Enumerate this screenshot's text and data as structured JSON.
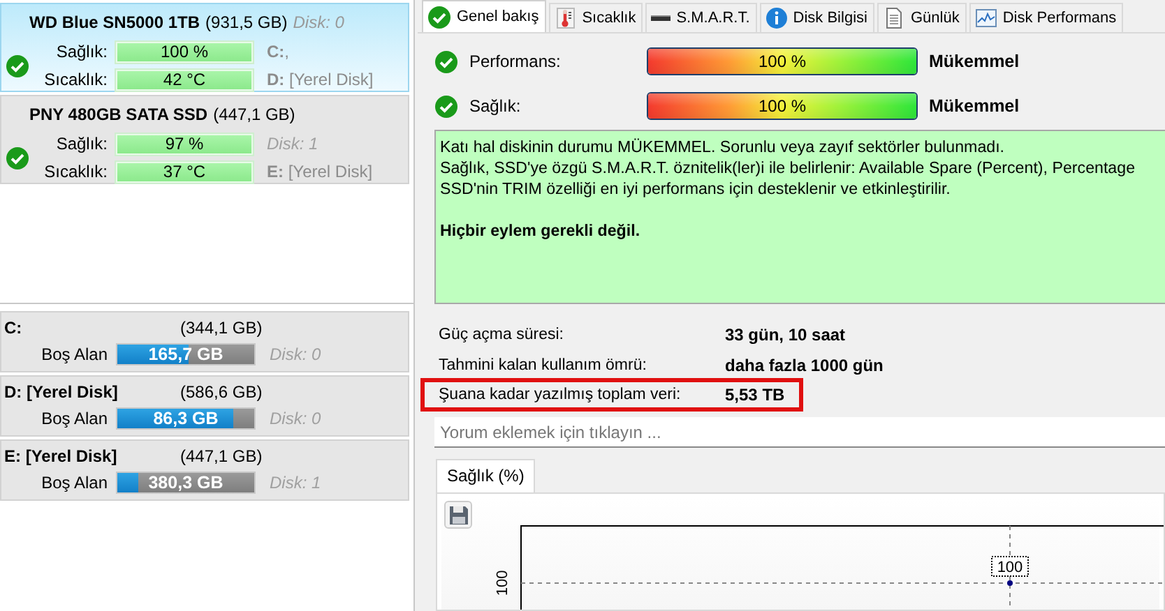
{
  "disks": [
    {
      "name": "WD Blue SN5000 1TB",
      "size": "(931,5 GB)",
      "disk": "Disk: 0",
      "selected": true,
      "rows": [
        {
          "label": "Sağlık:",
          "value": "100 %",
          "note": {
            "kind": "drive",
            "text": "**C:**,"
          }
        },
        {
          "label": "Sıcaklık:",
          "value": "42 °C",
          "note": {
            "kind": "drive",
            "text": "**D:** [Yerel Disk]"
          }
        }
      ]
    },
    {
      "name": "PNY 480GB SATA SSD",
      "size": "(447,1 GB)",
      "selected": false,
      "rows": [
        {
          "label": "Sağlık:",
          "value": "97 %",
          "note": {
            "kind": "disk",
            "text": "Disk: 1"
          }
        },
        {
          "label": "Sıcaklık:",
          "value": "37 °C",
          "note": {
            "kind": "drive",
            "text": "**E:** [Yerel Disk]"
          }
        }
      ]
    }
  ],
  "partitions": [
    {
      "name": "C:",
      "size": "(344,1 GB)",
      "label": "Boş Alan",
      "free": "165,7 GB",
      "level": 0.52,
      "disk": "Disk: 0"
    },
    {
      "name": "D: [Yerel Disk]",
      "size": "(586,6 GB)",
      "label": "Boş Alan",
      "free": "86,3 GB",
      "level": 0.85,
      "disk": "Disk: 0"
    },
    {
      "name": "E: [Yerel Disk]",
      "size": "(447,1 GB)",
      "label": "Boş Alan",
      "free": "380,3 GB",
      "level": 0.15,
      "disk": "Disk: 1"
    }
  ],
  "tabs": [
    {
      "label": "Genel bakış",
      "selected": true
    },
    {
      "label": "Sıcaklık",
      "selected": false
    },
    {
      "label": "S.M.A.R.T.",
      "selected": false
    },
    {
      "label": "Disk Bilgisi",
      "selected": false
    },
    {
      "label": "Günlük",
      "selected": false
    },
    {
      "label": "Disk Performans",
      "selected": false
    }
  ],
  "overview": [
    {
      "label": "Performans:",
      "level": 1,
      "value": "100 %",
      "verdict": "Mükemmel"
    },
    {
      "label": "Sağlık:",
      "level": 1,
      "value": "100 %",
      "verdict": "Mükemmel"
    }
  ],
  "message": {
    "lines": [
      "Katı hal diskinin durumu MÜKEMMEL. Sorunlu veya zayıf sektörler bulunmadı.",
      "Sağlık, SSD'ye özgü S.M.A.R.T. öznitelik(ler)i ile belirlenir:  Available Spare (Percent), Percentage",
      "SSD'nin TRIM özelliği en iyi performans için desteklenir ve etkinleştirilir."
    ],
    "action": "Hiçbir eylem gerekli değil."
  },
  "info": [
    {
      "label": "Güç açma süresi:",
      "value": "33 gün, 10 saat",
      "highlighted": false
    },
    {
      "label": "Tahmini kalan kullanım ömrü:",
      "value": "daha fazla 1000 gün",
      "highlighted": false
    },
    {
      "label": "Şuana kadar yazılmış toplam veri:",
      "value": "5,53 TB",
      "highlighted": true
    }
  ],
  "comment": {
    "placeholder": "Yorum eklemek için tıklayın ..."
  },
  "chart": {
    "tabs": [
      {
        "label": "Sağlık (%)",
        "selected": true
      }
    ],
    "axis_label": "100",
    "point_label": "100"
  }
}
